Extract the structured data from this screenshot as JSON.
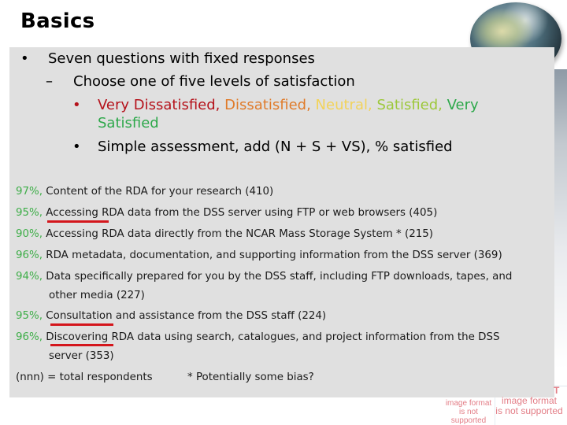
{
  "slide": {
    "title": "Basics"
  },
  "bullets": {
    "level1": "Seven questions with fixed responses",
    "level2": "Choose one of five levels of satisfaction",
    "level3_markers": [
      "•",
      "•"
    ],
    "level1_marker": "•",
    "level2_marker": "–",
    "satisfaction_levels": [
      {
        "label": "Very Dissatisfied,",
        "color": "#b5121b"
      },
      {
        "label": "Dissatisfied,",
        "color": "#e07b2a"
      },
      {
        "label": "Neutral,",
        "color": "#f2d35a"
      },
      {
        "label": "Satisfied,",
        "color": "#9dc83b"
      },
      {
        "label": "Very",
        "color": "#2da84a"
      },
      {
        "label": "Satisfied",
        "color": "#2da84a"
      }
    ],
    "assessment": "Simple assessment, add (N + S + VS), % satisfied"
  },
  "results": [
    {
      "pct": "97%,",
      "text": "Content of the RDA for your research (410)",
      "cont": ""
    },
    {
      "pct": "95%,",
      "text": "Accessing RDA data from the DSS server using FTP or web browsers (405)",
      "cont": ""
    },
    {
      "pct": "90%,",
      "text": "Accessing RDA data directly from the NCAR Mass Storage System * (215)",
      "cont": ""
    },
    {
      "pct": "96%,",
      "text": "RDA metadata, documentation, and supporting information from  the DSS server (369)",
      "cont": ""
    },
    {
      "pct": "94%,",
      "text": "Data specifically prepared for you by the DSS staff, including FTP downloads, tapes, and",
      "cont": "other media (227)"
    },
    {
      "pct": "95%,",
      "text": "Consultation and assistance from the DSS staff (224)",
      "cont": ""
    },
    {
      "pct": "96%,",
      "text": "Discovering RDA data using search, catalogues, and project information from the DSS",
      "cont": "server (353)"
    }
  ],
  "footnote": {
    "legend": "(nnn) = total respondents",
    "note": "* Potentially some bias?"
  },
  "placeholders": {
    "small": [
      "image format",
      "is not supported"
    ],
    "large": [
      "image format",
      "is not supported"
    ],
    "clipped_letter": "T"
  },
  "colors": {
    "panel": "#e0e0e0",
    "percent": "#3fae49",
    "underline": "#d4161c"
  }
}
